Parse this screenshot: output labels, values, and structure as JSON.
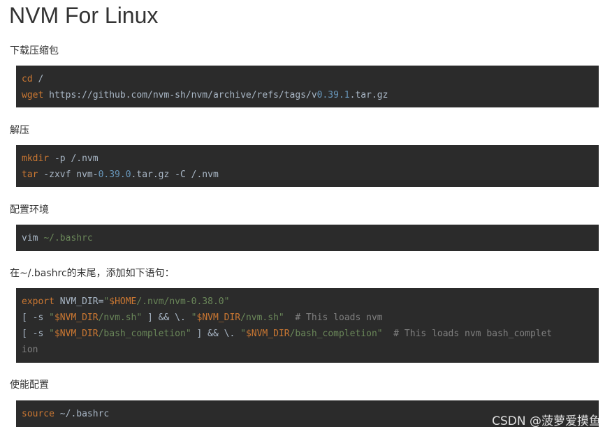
{
  "title": "NVM For Linux",
  "sections": [
    {
      "label": "下载压缩包",
      "lines": [
        [
          {
            "t": "cd",
            "c": "kw"
          },
          {
            "t": " /",
            "c": ""
          }
        ],
        [
          {
            "t": "wget",
            "c": "kw"
          },
          {
            "t": " https://github.com/nvm-sh/nvm/archive/refs/tags/v",
            "c": ""
          },
          {
            "t": "0.39.1",
            "c": "num"
          },
          {
            "t": ".tar.gz",
            "c": ""
          }
        ]
      ]
    },
    {
      "label": "解压",
      "lines": [
        [
          {
            "t": "mkdir",
            "c": "kw"
          },
          {
            "t": " -p /.nvm",
            "c": ""
          }
        ],
        [
          {
            "t": "tar",
            "c": "kw"
          },
          {
            "t": " -zxvf nvm-",
            "c": ""
          },
          {
            "t": "0.39.0",
            "c": "num"
          },
          {
            "t": ".tar.gz -C /.nvm",
            "c": ""
          }
        ]
      ]
    },
    {
      "label": "配置环境",
      "lines": [
        [
          {
            "t": "vim ",
            "c": ""
          },
          {
            "t": "~/.bashrc",
            "c": "str"
          }
        ]
      ]
    },
    {
      "label": "在~/.bashrc的末尾，添加如下语句：",
      "lines": [
        [
          {
            "t": "export",
            "c": "kw"
          },
          {
            "t": " NVM_DIR=",
            "c": ""
          },
          {
            "t": "\"",
            "c": "str"
          },
          {
            "t": "$HOME",
            "c": "var"
          },
          {
            "t": "/.nvm/nvm-0.38.0\"",
            "c": "str"
          }
        ],
        [
          {
            "t": "[ -s ",
            "c": ""
          },
          {
            "t": "\"",
            "c": "str"
          },
          {
            "t": "$NVM_DIR",
            "c": "var"
          },
          {
            "t": "/nvm.sh\"",
            "c": "str"
          },
          {
            "t": " ] && \\. ",
            "c": ""
          },
          {
            "t": "\"",
            "c": "str"
          },
          {
            "t": "$NVM_DIR",
            "c": "var"
          },
          {
            "t": "/nvm.sh\"",
            "c": "str"
          },
          {
            "t": "  # This loads nvm",
            "c": "cmt"
          }
        ],
        [
          {
            "t": "[ -s ",
            "c": ""
          },
          {
            "t": "\"",
            "c": "str"
          },
          {
            "t": "$NVM_DIR",
            "c": "var"
          },
          {
            "t": "/bash_completion\"",
            "c": "str"
          },
          {
            "t": " ] && \\. ",
            "c": ""
          },
          {
            "t": "\"",
            "c": "str"
          },
          {
            "t": "$NVM_DIR",
            "c": "var"
          },
          {
            "t": "/bash_completion\"",
            "c": "str"
          },
          {
            "t": "  # This loads nvm bash_complet",
            "c": "cmt"
          }
        ],
        [
          {
            "t": "ion",
            "c": "cmt"
          }
        ]
      ]
    },
    {
      "label": "使能配置",
      "lines": [
        [
          {
            "t": "source",
            "c": "kw"
          },
          {
            "t": " ~/.bashrc",
            "c": ""
          }
        ]
      ]
    }
  ],
  "watermark": "CSDN @菠萝爱摸鱼"
}
